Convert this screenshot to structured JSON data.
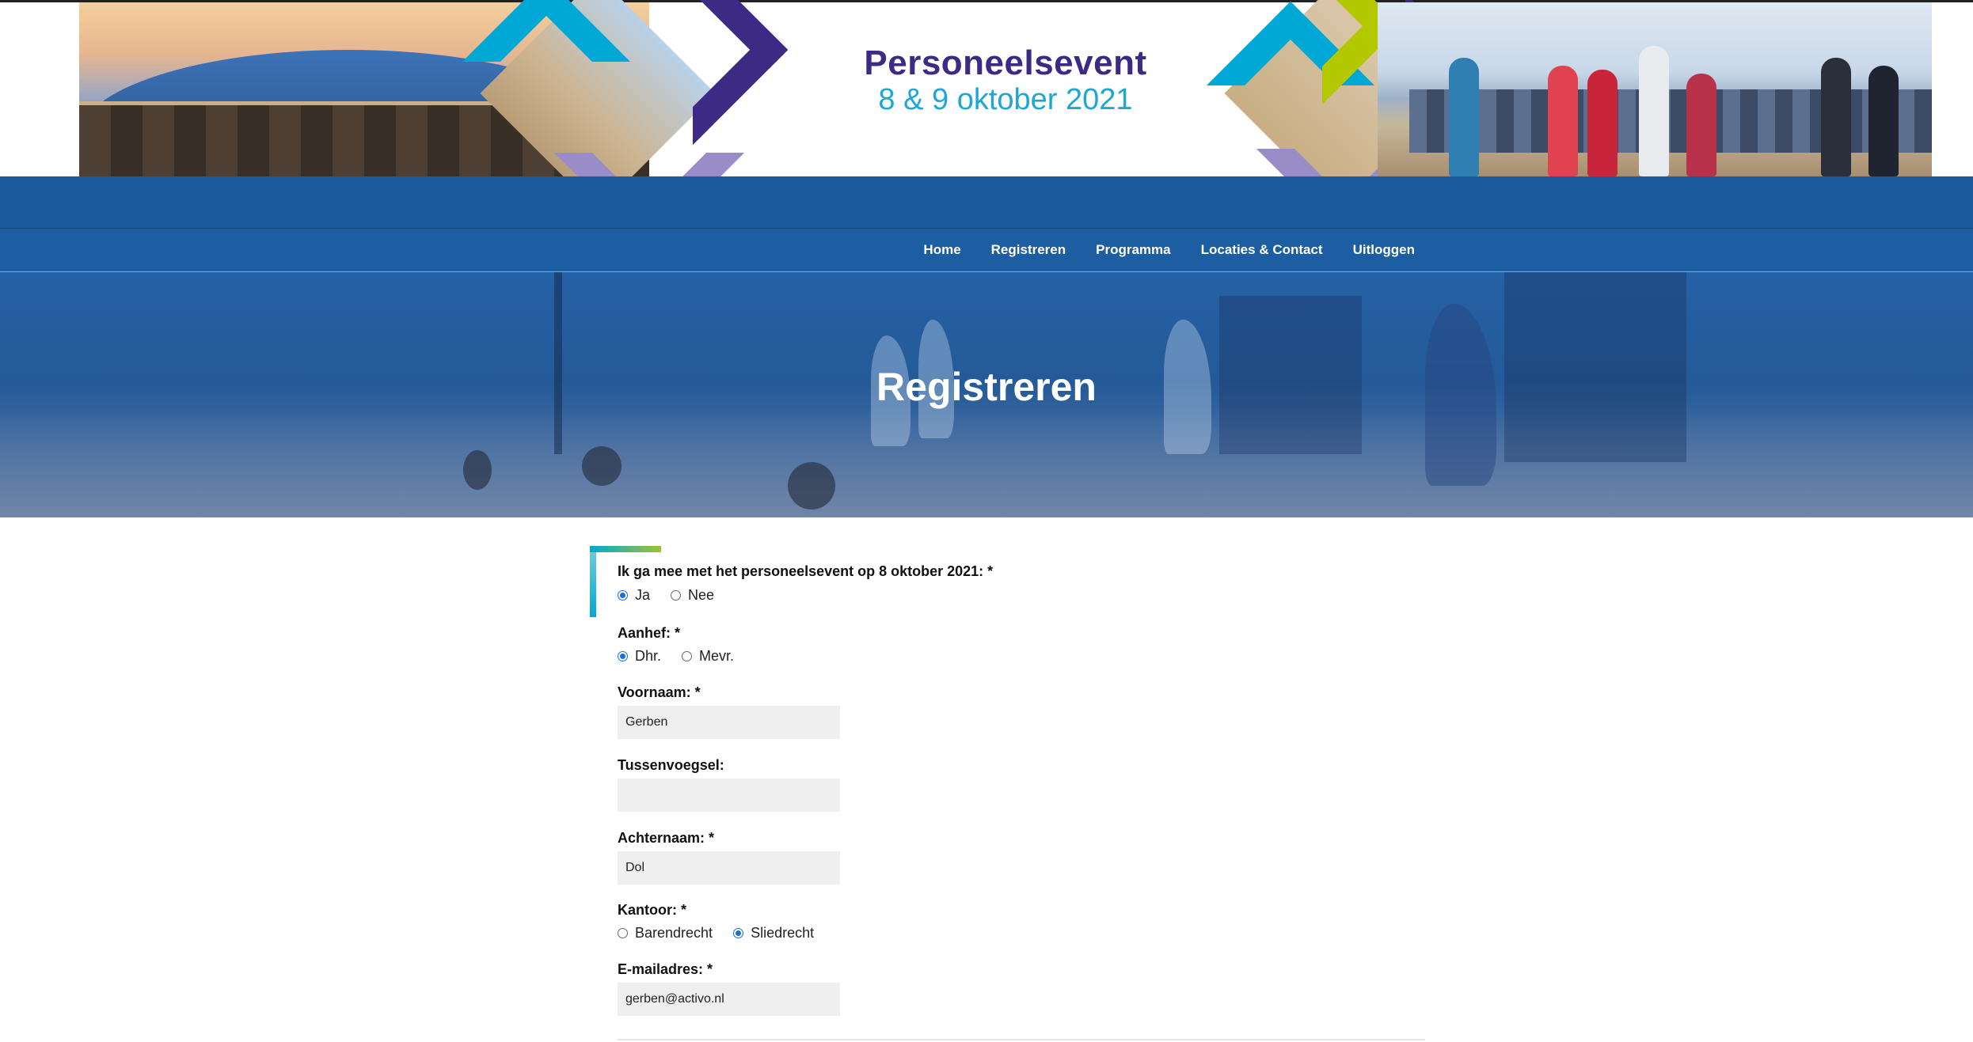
{
  "banner": {
    "title": "Personeelsevent",
    "date": "8 & 9 oktober 2021"
  },
  "nav": {
    "items": [
      "Home",
      "Registreren",
      "Programma",
      "Locaties & Contact",
      "Uitloggen"
    ]
  },
  "hero": {
    "title": "Registreren"
  },
  "form": {
    "attend": {
      "label": "Ik ga mee met het personeelsevent op 8 oktober 2021: *",
      "options": [
        "Ja",
        "Nee"
      ],
      "selected": "Ja"
    },
    "salutation": {
      "label": "Aanhef: *",
      "options": [
        "Dhr.",
        "Mevr."
      ],
      "selected": "Dhr."
    },
    "first_name": {
      "label": "Voornaam: *",
      "value": "Gerben"
    },
    "infix": {
      "label": "Tussenvoegsel:",
      "value": ""
    },
    "last_name": {
      "label": "Achternaam: *",
      "value": "Dol"
    },
    "office": {
      "label": "Kantoor: *",
      "options": [
        "Barendrecht",
        "Sliedrecht"
      ],
      "selected": "Sliedrecht"
    },
    "email": {
      "label": "E-mailadres: *",
      "value": "gerben@activo.nl"
    }
  },
  "colors": {
    "brand_purple": "#3d2a84",
    "brand_cyan": "#00a8d6",
    "brand_lilac": "#9a8cc6",
    "brand_lime": "#b4c800",
    "nav_blue": "#1d5da1"
  }
}
